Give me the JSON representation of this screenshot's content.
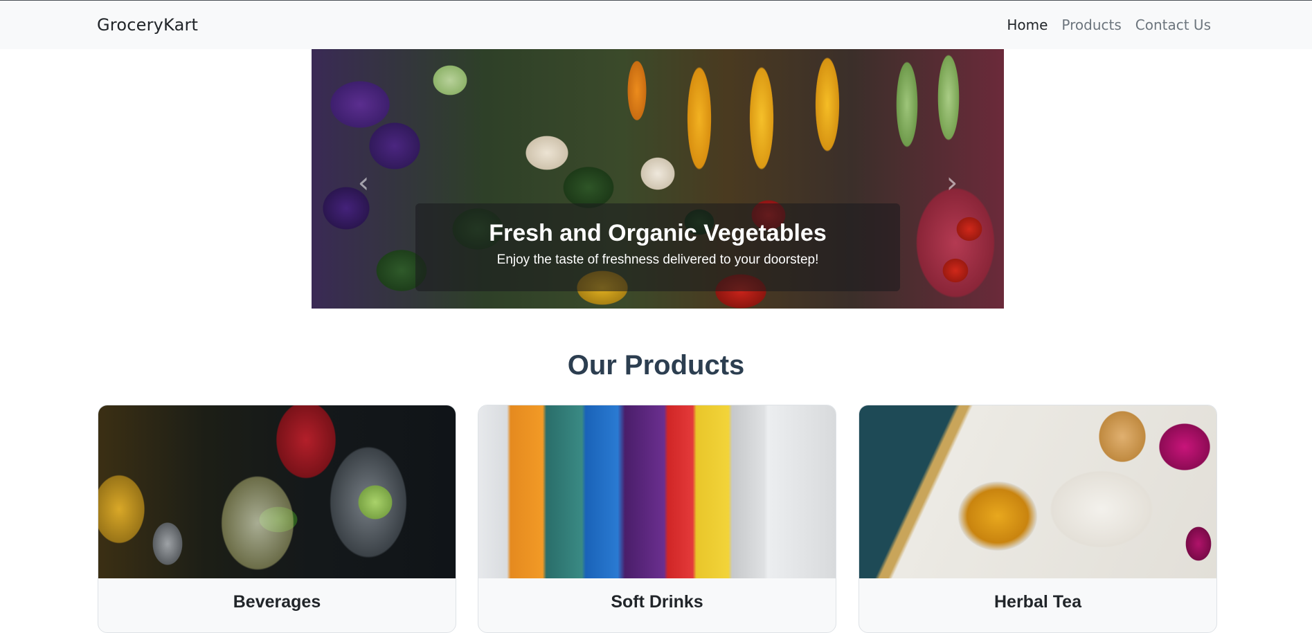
{
  "navbar": {
    "brand": "GroceryKart",
    "links": [
      {
        "label": "Home",
        "active": true
      },
      {
        "label": "Products",
        "active": false
      },
      {
        "label": "Contact Us",
        "active": false
      }
    ]
  },
  "carousel": {
    "slide_title": "Fresh and Organic Vegetables",
    "slide_text": "Enjoy the taste of freshness delivered to your doorstep!",
    "prev_icon": "chevron-left-icon",
    "next_icon": "chevron-right-icon"
  },
  "products": {
    "heading": "Our Products",
    "items": [
      {
        "title": "Beverages"
      },
      {
        "title": "Soft Drinks"
      },
      {
        "title": "Herbal Tea"
      }
    ]
  },
  "colors": {
    "navbar_bg": "#f8f9fa",
    "heading_color": "#2c3e50",
    "active_link": "#212529",
    "inactive_link": "#6c757d"
  }
}
